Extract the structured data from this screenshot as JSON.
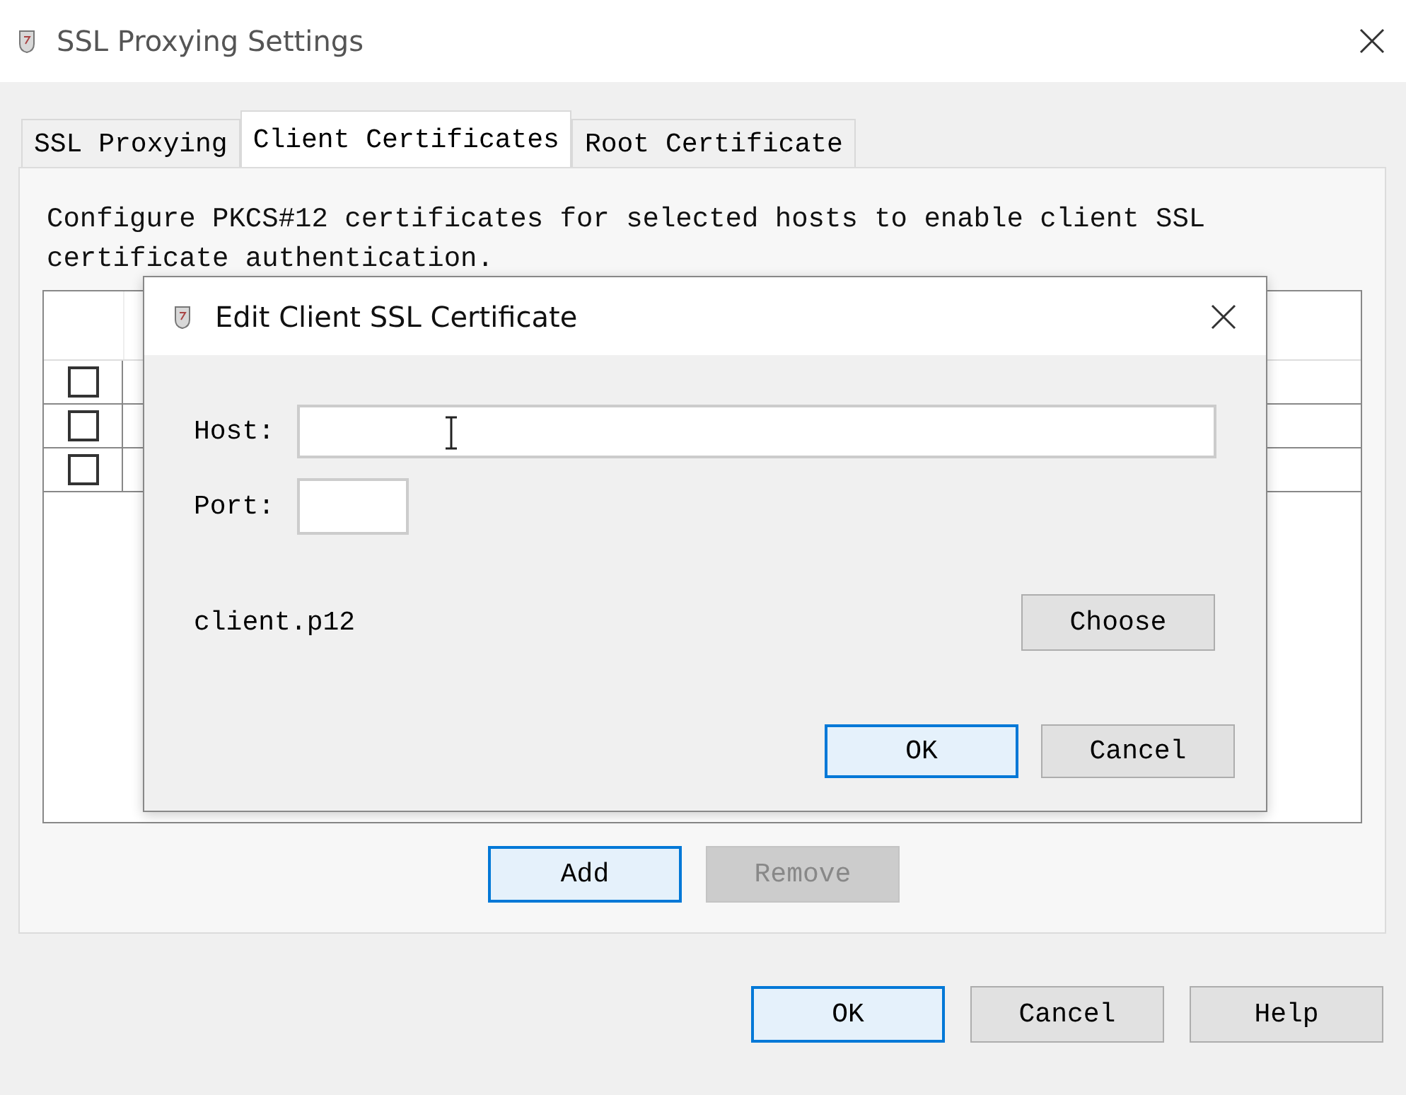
{
  "window": {
    "title": "SSL Proxying Settings"
  },
  "tabs": [
    {
      "label": "SSL Proxying",
      "selected": false
    },
    {
      "label": "Client Certificates",
      "selected": true
    },
    {
      "label": "Root Certificate",
      "selected": false
    }
  ],
  "description": "Configure PKCS#12 certificates for selected hosts to enable client SSL certificate authentication.",
  "table": {
    "rows": [
      {
        "checked": false
      },
      {
        "checked": false
      },
      {
        "checked": false
      }
    ]
  },
  "list_buttons": [
    {
      "label": "Add",
      "focused": true,
      "disabled": false
    },
    {
      "label": "Remove",
      "focused": false,
      "disabled": true
    }
  ],
  "buttons": [
    {
      "label": "OK",
      "focused": true
    },
    {
      "label": "Cancel",
      "focused": false
    },
    {
      "label": "Help",
      "focused": false
    }
  ],
  "dialog": {
    "title": "Edit Client SSL Certificate",
    "host_label": "Host:",
    "port_label": "Port:",
    "file": "client.p12",
    "choose": "Choose",
    "buttons": [
      {
        "label": "OK",
        "focused": true
      },
      {
        "label": "Cancel",
        "focused": false
      }
    ]
  }
}
